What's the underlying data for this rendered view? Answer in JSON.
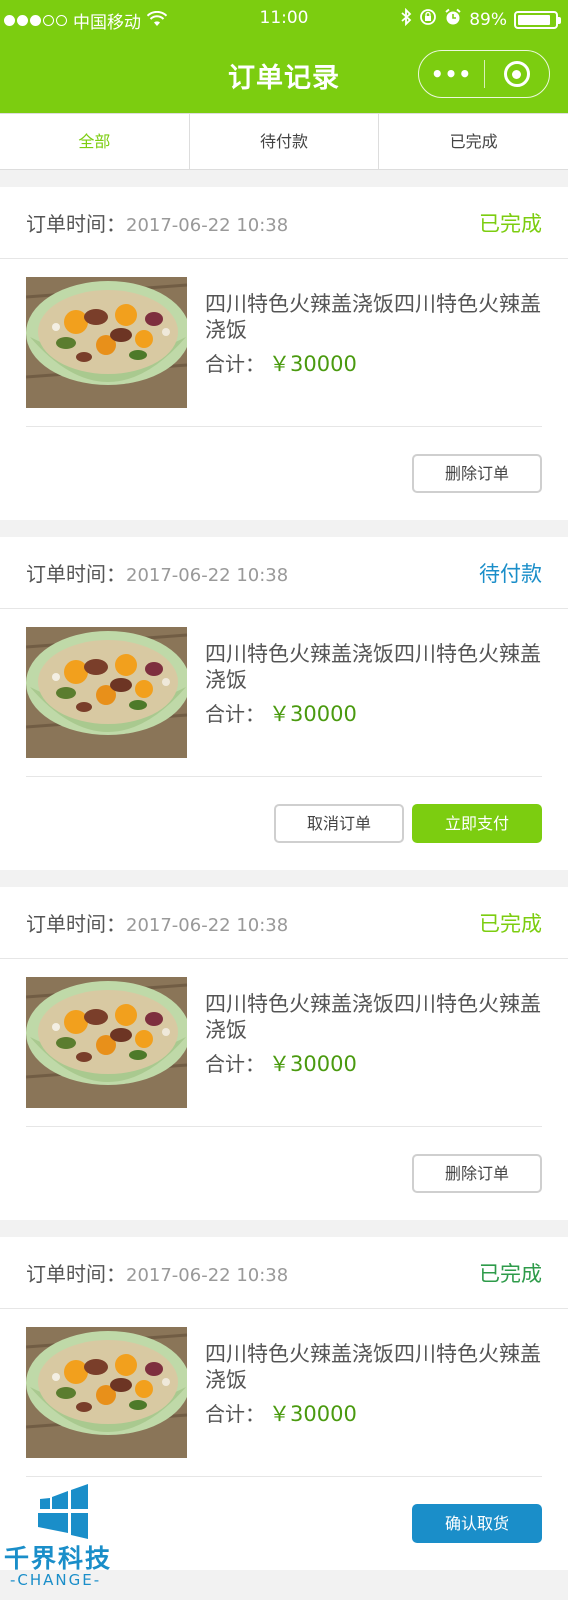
{
  "status_bar": {
    "carrier": "中国移动",
    "time": "11:00",
    "battery": "89%",
    "battery_level": 0.89,
    "signal_dots_filled": 3,
    "signal_dots_total": 5
  },
  "nav": {
    "title": "订单记录",
    "more_label": "•••"
  },
  "tabs": [
    {
      "label": "全部",
      "active": true
    },
    {
      "label": "待付款",
      "active": false
    },
    {
      "label": "已完成",
      "active": false
    }
  ],
  "orders": [
    {
      "time_label": "订单时间：",
      "time": "2017-06-22 10:38",
      "status": "已完成",
      "product_name": "四川特色火辣盖浇饭四川特色火辣盖浇饭",
      "total_label": "合计：",
      "total": "￥30000",
      "buttons": [
        "删除订单"
      ]
    },
    {
      "time_label": "订单时间：",
      "time": "2017-06-22 10:38",
      "status": "待付款",
      "product_name": "四川特色火辣盖浇饭四川特色火辣盖浇饭",
      "total_label": "合计：",
      "total": "￥30000",
      "buttons": [
        "取消订单",
        "立即支付"
      ]
    },
    {
      "time_label": "订单时间：",
      "time": "2017-06-22 10:38",
      "status": "已完成",
      "product_name": "四川特色火辣盖浇饭四川特色火辣盖浇饭",
      "total_label": "合计：",
      "total": "￥30000",
      "buttons": [
        "删除订单"
      ]
    },
    {
      "time_label": "订单时间：",
      "time": "2017-06-22 10:38",
      "status": "已完成",
      "product_name": "四川特色火辣盖浇饭四川特色火辣盖浇饭",
      "total_label": "合计：",
      "total": "￥30000",
      "buttons": [
        "确认取货"
      ]
    }
  ],
  "watermark": {
    "name": "千界科技",
    "sub": "-CHANGE-"
  },
  "colors": {
    "brand_green": "#7ccd10",
    "pending_blue": "#1a8ec9",
    "price_green": "#4a9a0f"
  }
}
